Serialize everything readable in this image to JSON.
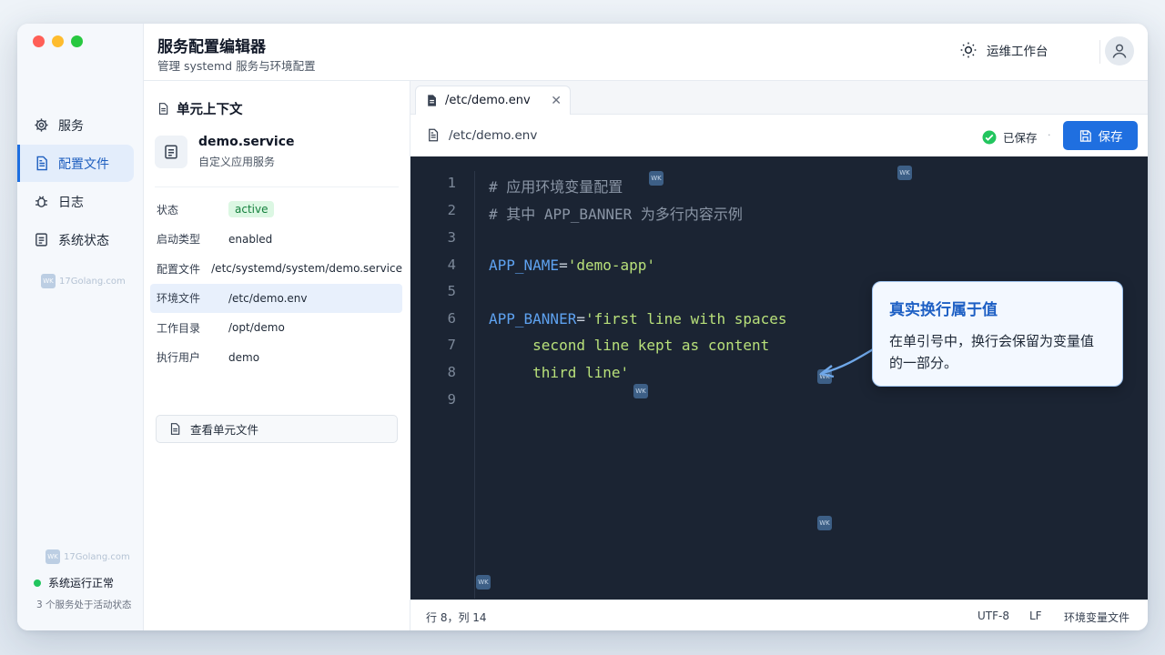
{
  "app": {
    "title": "服务配置编辑器",
    "subtitle": "管理 systemd 服务与环境配置",
    "workspace_label": "运维工作台",
    "workspace_icon": "sun-icon",
    "avatar_icon": "user-icon"
  },
  "window_controls": {
    "colors": [
      "#ff5f57",
      "#febc2e",
      "#28c840"
    ]
  },
  "sidebar": {
    "items": [
      {
        "label": "服务",
        "icon": "gear-icon",
        "active": false
      },
      {
        "label": "配置文件",
        "icon": "document-icon",
        "active": true
      },
      {
        "label": "日志",
        "icon": "bug-icon",
        "active": false
      },
      {
        "label": "系统状态",
        "icon": "status-icon",
        "active": false
      }
    ],
    "status": {
      "label": "系统运行正常",
      "detail": "3 个服务处于活动状态"
    },
    "watermark": "17Golang.com"
  },
  "context": {
    "title": "单元上下文",
    "unit": {
      "name": "demo.service",
      "description": "自定义应用服务"
    },
    "properties": [
      {
        "key": "状态",
        "value": "active",
        "badge": true
      },
      {
        "key": "启动类型",
        "value": "enabled"
      },
      {
        "key": "配置文件",
        "value": "/etc/systemd/system/demo.service"
      },
      {
        "key": "环境文件",
        "value": "/etc/demo.env",
        "highlight": true
      },
      {
        "key": "工作目录",
        "value": "/opt/demo"
      },
      {
        "key": "执行用户",
        "value": "demo"
      }
    ],
    "view_button": "查看单元文件"
  },
  "editor": {
    "tab_label": "/etc/demo.env",
    "path": "/etc/demo.env",
    "saved_status": "已保存",
    "save_button": "保存",
    "line_numbers": [
      "1",
      "2",
      "3",
      "4",
      "5",
      "6",
      "7",
      "8",
      "9"
    ],
    "lines": [
      {
        "comment": "# 应用环境变量配置"
      },
      {
        "comment": "# 其中 APP_BANNER 为多行内容示例"
      },
      {},
      {
        "key": "APP_NAME",
        "op": "=",
        "str": "'demo-app'"
      },
      {},
      {
        "key": "APP_BANNER",
        "op": "=",
        "str": "'first line with spaces"
      },
      {
        "str": "     second line kept as content"
      },
      {
        "str": "     third line'"
      },
      {}
    ],
    "callout": {
      "title": "真实换行属于值",
      "text": "在单引号中，换行会保留为变量值的一部分。"
    }
  },
  "statusbar": {
    "position": "行 8，列 14",
    "encoding": "UTF-8",
    "eol": "LF",
    "file_type": "环境变量文件"
  },
  "colors": {
    "accent": "#1f6fe0",
    "editor_bg": "#1b2433",
    "key": "#5ea2f0",
    "string": "#b8e07a",
    "success": "#22c55e"
  }
}
